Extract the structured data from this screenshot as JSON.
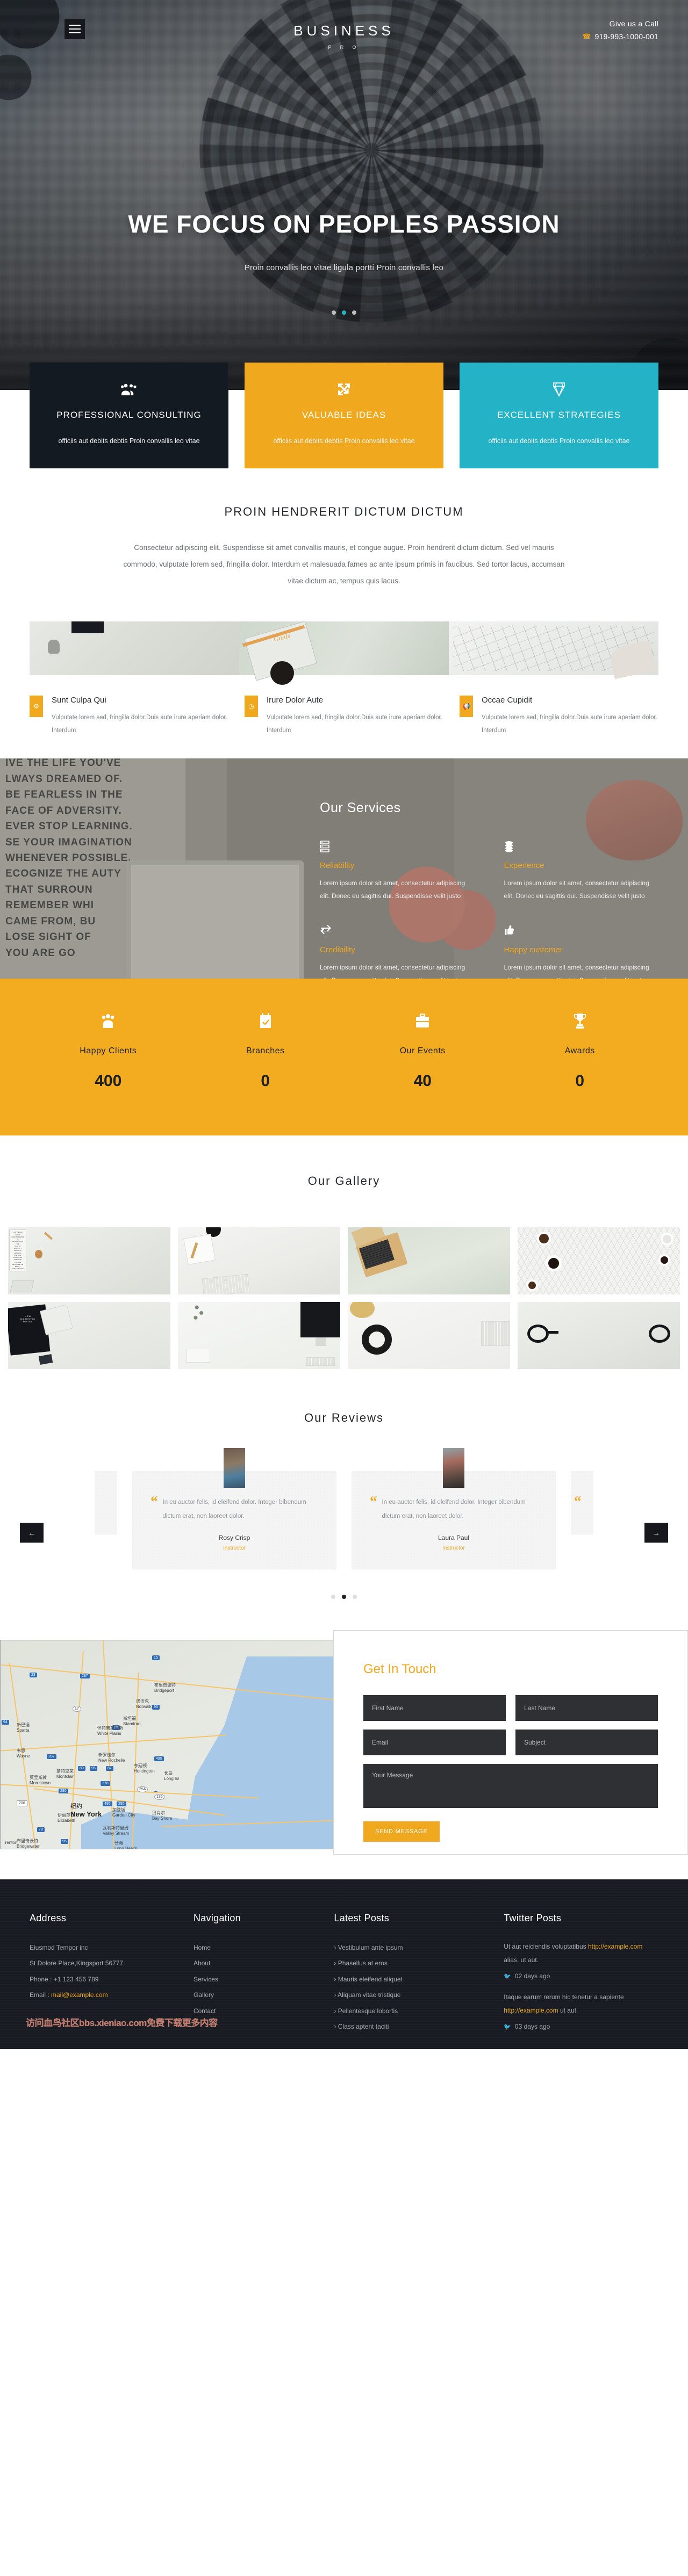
{
  "hero": {
    "menu_icon": "hamburger-menu-icon",
    "brand_main": "BUSINESS",
    "brand_sub": "P R O",
    "call_label": "Give us a Call",
    "call_number": "919-993-1000-001",
    "phone_icon": "phone-icon",
    "headline": "WE FOCUS ON PEOPLES PASSION",
    "subline": "Proin convallis leo vitae ligula portti Proin convallis leo",
    "slider_dots": 3,
    "slider_active_index": 1,
    "accent_teal": "#24b3c6"
  },
  "cards": [
    {
      "icon": "users-group-icon",
      "title": "PROFESSIONAL CONSULTING",
      "text": "officiis aut debits debtis Proin convallis leo vitae",
      "bg": "#141a22"
    },
    {
      "icon": "expand-arrows-icon",
      "title": "VALUABLE IDEAS",
      "text": "officiis aut debits debtis Proin convallis leo vitae",
      "bg": "#f0a81e"
    },
    {
      "icon": "diamond-icon",
      "title": "EXCELLENT STRATEGIES",
      "text": "officiis aut debits debtis Proin convallis leo vitae",
      "bg": "#24b3c6"
    }
  ],
  "intro": {
    "title": "PROIN HENDRERIT DICTUM DICTUM",
    "paragraph": "Consectetur adipiscing elit. Suspendisse sit amet convallis mauris, et congue augue. Proin hendrerit dictum dictum. Sed vel mauris commodo, vulputate lorem sed, fringilla dolor. Interdum et malesuada fames ac ante ipsum primis in faucibus. Sed tortor lacus, accumsan vitae dictum ac, tempus quis lacus."
  },
  "feature_items": [
    {
      "icon": "gear-icon",
      "title": "Sunt Culpa Qui",
      "text": "Vulputate lorem sed, fringilla dolor.Duis aute irure aperiam dolor. Interdum"
    },
    {
      "icon": "clock-icon",
      "title": "Irure Dolor Aute",
      "text": "Vulputate lorem sed, fringilla dolor.Duis aute irure aperiam dolor. Interdum"
    },
    {
      "icon": "megaphone-icon",
      "title": "Occae Cupidit",
      "text": "Vulputate lorem sed, fringilla dolor.Duis aute irure aperiam dolor. Interdum"
    }
  ],
  "services": {
    "title": "Our Services",
    "poster_lines": [
      "IVE THE LIFE YOU'VE",
      "LWAYS  DREAMED OF.",
      "BE FEARLESS IN THE",
      "FACE OF ADVERSITY.",
      "EVER STOP LEARNING.",
      "SE YOUR IMAGINATION",
      "WHENEVER POSSIBLE.",
      "ECOGNIZE THE    AUTY",
      "THAT SURROUN",
      "REMEMBER WHI",
      "CAME FROM, BU",
      "LOSE SIGHT OF",
      "YOU ARE GO"
    ],
    "items": [
      {
        "icon": "server-icon",
        "title": "Reliability",
        "text": "Lorem ipsum dolor sit amet, consectetur adipiscing elit. Donec eu sagittis dui. Suspendisse velit justo"
      },
      {
        "icon": "coins-stack-icon",
        "title": "Experience",
        "text": "Lorem ipsum dolor sit amet, consectetur adipiscing elit. Donec eu sagittis dui. Suspendisse velit justo"
      },
      {
        "icon": "exchange-arrows-icon",
        "title": "Credibility",
        "text": "Lorem ipsum dolor sit amet, consectetur adipiscing elit. Donec eu sagittis dui. Suspendisse velit justo"
      },
      {
        "icon": "thumbs-up-icon",
        "title": "Happy customer",
        "text": "Lorem ipsum dolor sit amet, consectetur adipiscing elit. Donec eu sagittis dui. Suspendisse velit justo"
      }
    ]
  },
  "stats": {
    "bg": "#f3ab1f",
    "items": [
      {
        "icon": "users-group-icon",
        "label": "Happy Clients",
        "value": "400"
      },
      {
        "icon": "calendar-check-icon",
        "label": "Branches",
        "value": "0"
      },
      {
        "icon": "briefcase-icon",
        "label": "Our Events",
        "value": "40"
      },
      {
        "icon": "trophy-icon",
        "label": "Awards",
        "value": "0"
      }
    ]
  },
  "gallery": {
    "title": "Our Gallery",
    "cells": [
      "desk-with-poster-and-laptop",
      "notebook-watch-keyboard-flatlay",
      "tilted-laptop-on-table",
      "coffee-cups-and-beans-hexagon-tiles",
      "black-majestic-hotel-tote-bag",
      "imac-with-books-and-plant",
      "espresso-cup-typography-with-keyboard",
      "black-eyeglasses-closeup"
    ]
  },
  "reviews": {
    "title": "Our Reviews",
    "prev_icon": "arrow-left-icon",
    "next_icon": "arrow-right-icon",
    "dots": 3,
    "active_dot_index": 1,
    "items": [
      {
        "quote": "In eu auctor felis, id eleifend dolor. Integer bibendum dictum erat, non laoreet dolor.",
        "name": "Rosy Crisp",
        "role": "Instructor"
      },
      {
        "quote": "In eu auctor felis, id eleifend dolor. Integer bibendum dictum erat, non laoreet dolor.",
        "name": "Laura Paul",
        "role": "Instructor"
      }
    ]
  },
  "map": {
    "labels": [
      {
        "cn": "新巴達",
        "en": "Sparta"
      },
      {
        "cn": "韦恩",
        "en": "Wayne"
      },
      {
        "cn": "蒙特克莱",
        "en": "Montclair"
      },
      {
        "cn": "莫里斯敦",
        "en": "Morristown"
      },
      {
        "cn": "伊丽莎白",
        "en": "Elizabeth"
      },
      {
        "cn": "纽约",
        "en": "New York"
      },
      {
        "cn": "怀特普莱恩斯",
        "en": "White Plains"
      },
      {
        "cn": "斯坦福",
        "en": "Stamford"
      },
      {
        "cn": "诺沃克",
        "en": "Norwalk"
      },
      {
        "cn": "布里奇波特",
        "en": "Bridgeport"
      },
      {
        "cn": "新罗谢尔",
        "en": "New Rochelle"
      },
      {
        "cn": "亨廷顿",
        "en": "Huntington"
      },
      {
        "cn": "加登城",
        "en": "Garden City"
      },
      {
        "cn": "贝肖尔",
        "en": "Bay Shore"
      },
      {
        "cn": "瓦利斯特里姆",
        "en": "Valley Stream"
      },
      {
        "cn": "长岛",
        "en": "Long Isl"
      },
      {
        "cn": "布里奇沃特",
        "en": "Bridgewater"
      },
      {
        "cn": "特伦顿",
        "en": "Trenton"
      },
      {
        "cn": "长滩",
        "en": "Long Beach"
      }
    ],
    "route_shields": [
      "23",
      "287",
      "17",
      "94",
      "95",
      "287",
      "80",
      "95",
      "87",
      "278",
      "280",
      "206",
      "495",
      "295",
      "135",
      "25A",
      "78",
      "95",
      "15"
    ]
  },
  "contact": {
    "title": "Get In Touch",
    "first_name_placeholder": "First Name",
    "first_name_value": "",
    "last_name_placeholder": "Last Name",
    "last_name_value": "",
    "email_placeholder": "Email",
    "email_value": "",
    "subject_placeholder": "Subject",
    "subject_value": "",
    "message_placeholder": "Your Message",
    "message_value": "",
    "send_label": "SEND MESSAGE"
  },
  "footer": {
    "address": {
      "heading": "Address",
      "company": "Eiusmod Tempor inc",
      "street": "St Dolore Place,Kingsport 56777.",
      "phone": "Phone : +1 123 456 789",
      "email_label": "Email : ",
      "email": "mail@example.com"
    },
    "navigation": {
      "heading": "Navigation",
      "links": [
        "Home",
        "About",
        "Services",
        "Gallery",
        "Contact"
      ]
    },
    "latest_posts": {
      "heading": "Latest Posts",
      "items": [
        "Vestibulum ante ipsum",
        "Phasellus at eros",
        "Mauris eleifend aliquet",
        "Aliquam vitae tristique",
        "Pellentesque lobortis",
        "Class aptent taciti"
      ]
    },
    "twitter": {
      "heading": "Twitter Posts",
      "tweets": [
        {
          "pre": "Ut aut reiciendis voluptatibus ",
          "link": "http://example.com",
          "post": " alias, ut aut.",
          "time": "02 days ago"
        },
        {
          "pre": "Itaque earum rerum hic tenetur a sapiente ",
          "link": "http://example.com",
          "post": " ut aut.",
          "time": "03 days ago"
        }
      ]
    },
    "watermark": "访问血鸟社区bbs.xieniao.com免费下载更多内容"
  }
}
